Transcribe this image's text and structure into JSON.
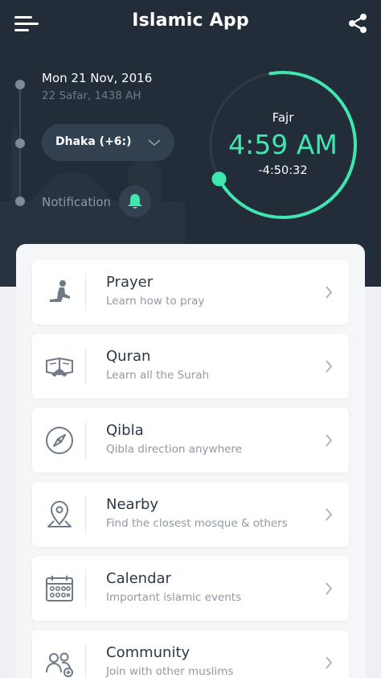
{
  "header": {
    "app_title": "Islamic App",
    "date": "Mon 21 Nov, 2016",
    "hijri_date": "22 Safar, 1438 AH",
    "city": "Dhaka (+6:)",
    "notification_label": "Notification"
  },
  "clock": {
    "prayer": "Fajr",
    "time": "4:59 AM",
    "countdown": "-4:50:32",
    "accent_color": "#3fe6b0"
  },
  "menu": [
    {
      "title": "Prayer",
      "subtitle": "Learn how to pray",
      "icon": "praying-person-icon"
    },
    {
      "title": "Quran",
      "subtitle": "Learn all the Surah",
      "icon": "open-book-icon"
    },
    {
      "title": "Qibla",
      "subtitle": "Qibla direction anywhere",
      "icon": "compass-icon"
    },
    {
      "title": "Nearby",
      "subtitle": "Find the closest mosque & others",
      "icon": "map-pin-icon"
    },
    {
      "title": "Calendar",
      "subtitle": "Important islamic events",
      "icon": "calendar-icon"
    },
    {
      "title": "Community",
      "subtitle": "Join with other muslims",
      "icon": "people-icon"
    }
  ],
  "colors": {
    "header_bg": "#232d3a",
    "accent": "#3fe6b0",
    "card_bg": "#ffffff",
    "page_bg": "#eef0f3"
  }
}
